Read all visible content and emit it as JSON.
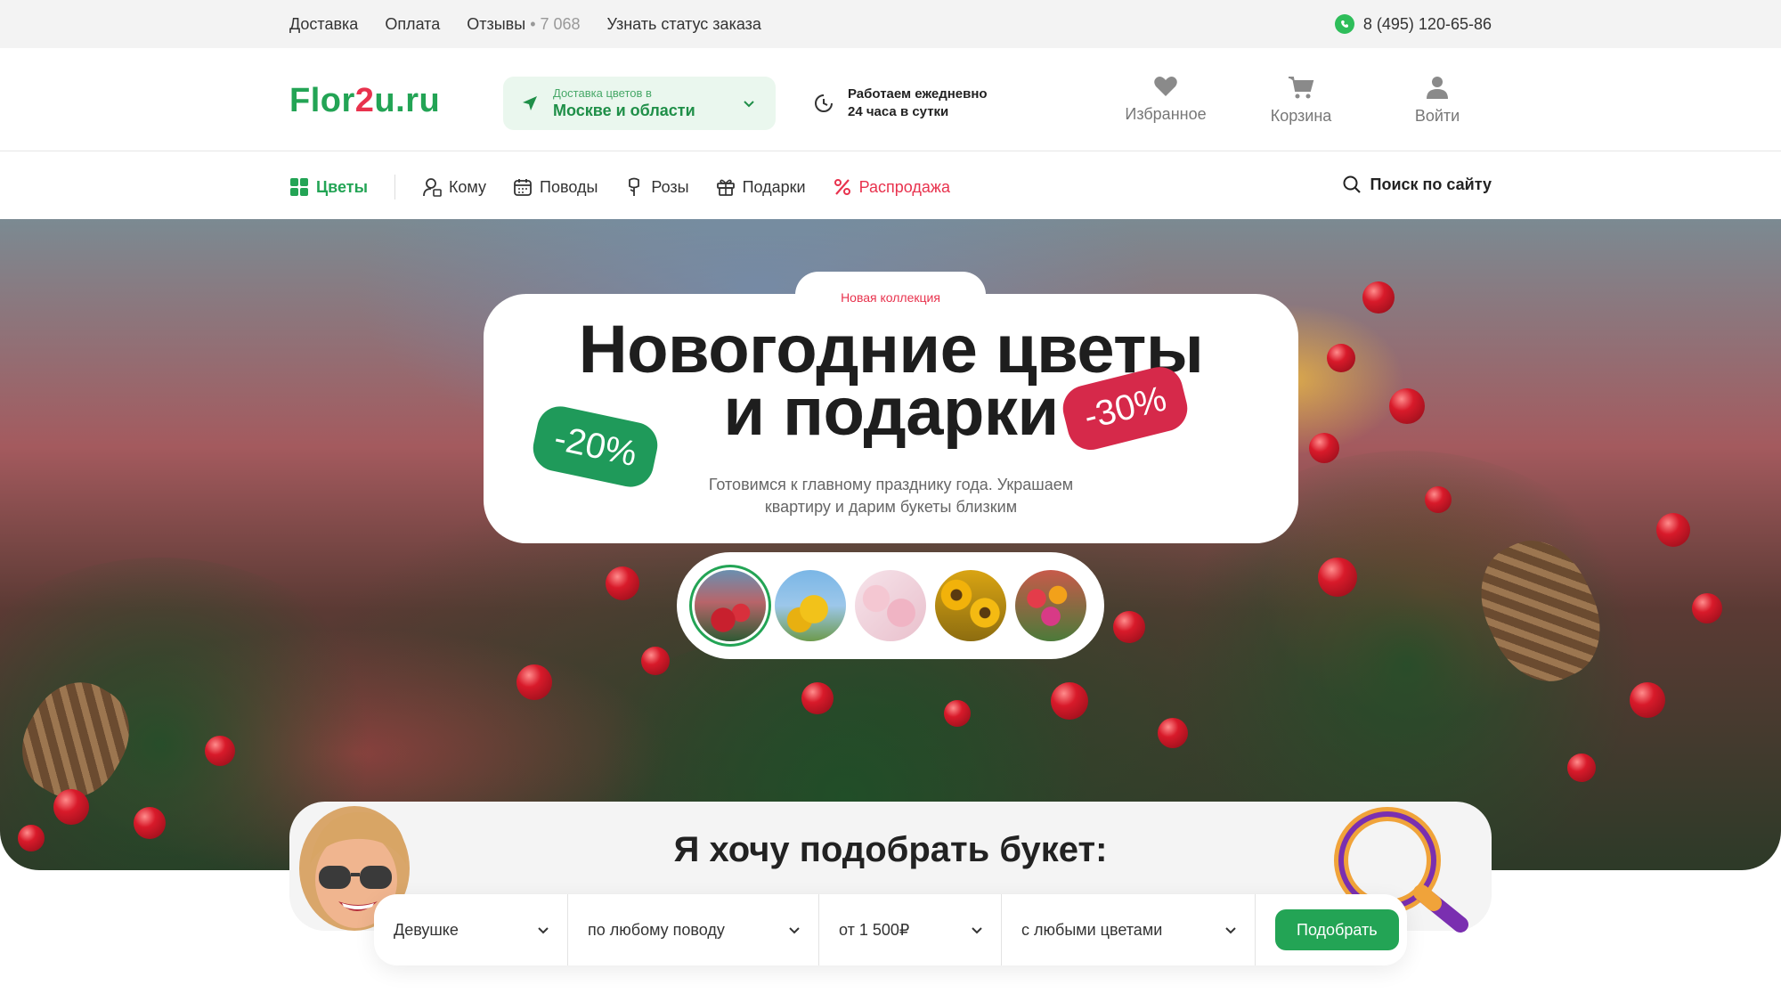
{
  "topbar": {
    "links": [
      "Доставка",
      "Оплата",
      "Отзывы",
      "Узнать статус заказа"
    ],
    "reviews_count": "7 068",
    "phone": "8 (495) 120-65-86"
  },
  "header": {
    "logo_part1": "Flor",
    "logo_part2": "2",
    "logo_part3": "u.ru",
    "region_caption": "Доставка цветов в",
    "region_value": "Москве и области",
    "hours_line1": "Работаем ежедневно",
    "hours_line2": "24 часа в сутки",
    "favorites": "Избранное",
    "cart": "Корзина",
    "login": "Войти"
  },
  "nav": {
    "flowers": "Цветы",
    "whom": "Кому",
    "occasions": "Поводы",
    "roses": "Розы",
    "gifts": "Подарки",
    "sale": "Распродажа",
    "search": "Поиск по сайту"
  },
  "hero": {
    "badge": "Новая коллекция",
    "title_line1": "Новогодние цветы",
    "title_line2": "и подарки",
    "subtitle_line1": "Готовимся к главному празднику года. Украшаем",
    "subtitle_line2": "квартиру и дарим букеты близким",
    "tag_green": "-20%",
    "tag_red": "-30%",
    "thumbnails": [
      "winter-bouquet",
      "yellow-flowers",
      "pink-blossom",
      "sunflowers",
      "tulips"
    ]
  },
  "picker": {
    "title": "Я хочу подобрать букет:",
    "recipient": "Девушке",
    "occasion": "по любому поводу",
    "price": "от 1 500₽",
    "flowers": "с любыми цветами",
    "submit": "Подобрать"
  },
  "colors": {
    "brand_green": "#23a455",
    "brand_red": "#e8324d"
  }
}
